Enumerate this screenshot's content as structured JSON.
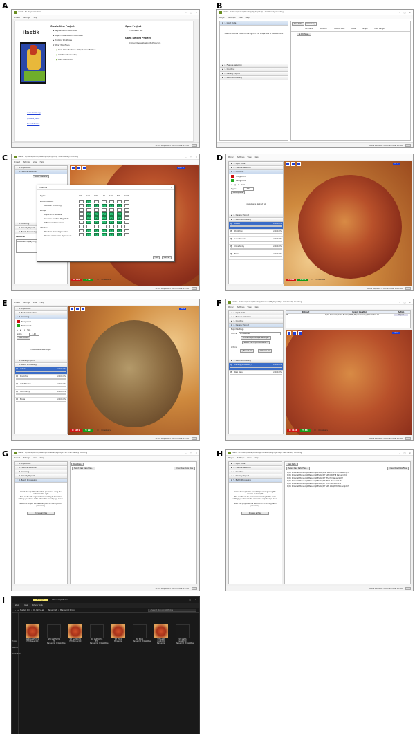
{
  "panels": {
    "A": {
      "letter": "A",
      "title": "ilastik - No Project Loaded",
      "menu": [
        "Project",
        "Settings",
        "Help"
      ],
      "logo_text": "ilastik",
      "create_heading": "Create New Project",
      "workflows": [
        "Segmentation Workflows",
        "Object Classification Workflows",
        "Tracking Workflows",
        "Other Workflows"
      ],
      "other_items": [
        "Pixel Classification + Object Classification",
        "Cell Density Counting",
        "Data Conversion"
      ],
      "open_heading": "Open Project",
      "browse": "Browse Files",
      "recent_heading": "Open Recent Project",
      "recent_item": "C:\\Users\\Owner\\Desktop\\MyProject.ilp",
      "links": [
        "www.ilastik.org",
        "@ilastik_team",
        "Switch Theme"
      ],
      "status": "Active Requests: 0  Cached Data: 0.0 MB"
    },
    "B": {
      "letter": "B",
      "title": "ilastik - C:/Users/Owner/Desktop/MyProject.ilp - Cell Density Counting",
      "menu": [
        "Project",
        "Settings",
        "View",
        "Help"
      ],
      "applets": [
        "1. Input Data",
        "2. Feature Selection",
        "3. Counting",
        "4. Density Export",
        "5. Batch Processing"
      ],
      "hint": "Use the controls shown to the right to add image files to this workflow.",
      "tabs": [
        "Raw Data",
        "Summary"
      ],
      "columns": [
        "Nickname",
        "Location",
        "Internal Path",
        "Axes",
        "Shape",
        "Data Range"
      ],
      "add_button": "Add New...",
      "status": "Active Requests: 0  Cached Data: 0.0 MB"
    },
    "C": {
      "letter": "C",
      "title": "ilastik - C:/Users/Owner/Desktop/MyProject.ilp - Cell Density Counting",
      "menu": [
        "Project",
        "Settings",
        "View",
        "Help"
      ],
      "applets": [
        "1. Input Data",
        "2. Feature Selection"
      ],
      "select_btn": "Select Features",
      "dialog_title": "Features",
      "sigma_label": "Sigma",
      "sigmas": [
        "0.30",
        "0.70",
        "1.00",
        "1.60",
        "3.50",
        "5.00",
        "10.00"
      ],
      "feature_rows": [
        "Color/Intensity",
        "Gaussian Smoothing",
        "Edge",
        "Laplacian of Gaussian",
        "Gaussian Gradient Magnitude",
        "Difference of Gaussians",
        "Texture",
        "Structure Tensor Eigenvalues",
        "Hessian of Gaussian Eigenvalues"
      ],
      "ok": "OK",
      "cancel": "Cancel",
      "below_applets": [
        "3. Counting",
        "4. Density Export",
        "5. Batch Processing"
      ],
      "features_label": "Features",
      "features_item": "Raw Data (display only)",
      "x_val": "X: 665",
      "y_val": "Y: 397",
      "crosshair": "Crosshairs",
      "zoom": "100 %",
      "status": "Active Requests: 0  Cached Data: 0.0 MB"
    },
    "D": {
      "letter": "D",
      "menu": [
        "Project",
        "Settings",
        "View",
        "Help"
      ],
      "applets": [
        "1. Input Data",
        "2. Feature Selection",
        "3. Counting"
      ],
      "labels": [
        "Foreground",
        "Background"
      ],
      "size_label": "Size",
      "sigma_label": "Sigma",
      "sigma_value": "3.43",
      "live_update": "Live Update",
      "no_boxes": "no elements defined yet",
      "below_applets": [
        "4. Density Export",
        "5. Batch Processing"
      ],
      "layers": [
        "Labels",
        "Prediction",
        "LabelPreview",
        "Uncertainty",
        "Boxes"
      ],
      "x_val": "X: 812",
      "y_val": "Y: 215",
      "crosshair": "Crosshairs",
      "zoom": "51 %",
      "status": "Active Requests: 0  Cached Data: 135.0 MB"
    },
    "E": {
      "letter": "E",
      "menu": [
        "Project",
        "Settings",
        "View",
        "Help"
      ],
      "applets": [
        "1. Input Data",
        "2. Feature Selection",
        "3. Counting"
      ],
      "labels": [
        "Foreground",
        "Background"
      ],
      "size_label": "Size",
      "sigma_label": "Sigma",
      "sigma_value": "3.43",
      "live_update": "Live Update",
      "no_boxes": "no elements defined yet",
      "below_applets": [
        "4. Density Export",
        "5. Batch Processing"
      ],
      "layers": [
        "Labels",
        "Prediction",
        "LabelPreview",
        "Uncertainty",
        "Boxes"
      ],
      "x_val": "X: 1071",
      "y_val": "Y: 222",
      "crosshair": "Crosshairs",
      "zoom": "54 %",
      "status": "Active Requests: 0  Cached Data: 0.0 MB"
    },
    "F": {
      "letter": "F",
      "title": "ilastik - C:/Users/Owner/Desktop/Processed/MyProject.ilp - Cell Density Counting",
      "menu": [
        "Project",
        "Settings",
        "View",
        "Help"
      ],
      "applets": [
        "1. Input Data",
        "2. Feature Selection",
        "3. Counting",
        "4. Density Export"
      ],
      "export_settings": "Export Settings",
      "source_label": "Source:",
      "source_value": "Probabilities",
      "choose_btn": "Choose Export Image Settings...",
      "select_btn": "Select CSV Export Location...",
      "actions_label": "Actions",
      "export_all": "Export All",
      "delete_all": "Delete All",
      "below_applets": [
        "5. Batch Processing"
      ],
      "layers": [
        "Density (Probability)",
        "Raw Data"
      ],
      "table_headers": [
        "Dataset",
        "Export Location",
        "Action"
      ],
      "table_row": [
        "Pf1",
        "D:/Dr. Kim's Lab/Poster Photos/WT Pf1/Pf1/{nickname}_Probabilities.h5",
        "Export"
      ],
      "x_val": "X: 1138",
      "y_val": "Y: 832",
      "crosshair": "Crosshairs",
      "zoom": "100 %",
      "status": "Active Requests: 0  Cached Data: 8.0 MB"
    },
    "G": {
      "letter": "G",
      "title": "ilastik - C:/Users/Owner/Desktop/Processed/MyProject.ilp - Cell Density Counting",
      "menu": [
        "Project",
        "Settings",
        "View",
        "Help"
      ],
      "applets": [
        "1. Input Data",
        "2. Feature Selection",
        "3. Counting",
        "4. Density Export",
        "5. Batch Processing"
      ],
      "tab": "Raw Data",
      "select_btn": "Select Raw Data Files...",
      "clear_btn": "Clear Raw Data Files",
      "instructions": "Select the input files for batch processing using the controls on the right.",
      "instructions2": "The results will be generated according to the same settings you chose in the interactive export page above.",
      "note": "Note: this project will be saved prior to running batch processing.",
      "process_btn": "Process all files",
      "status": "Active Requests: 0  Cached Data: 0.0 MB"
    },
    "H": {
      "letter": "H",
      "title": "ilastik - C:/Users/Owner/Desktop/Processed/MyProject.ilp - Cell Density Counting",
      "menu": [
        "Project",
        "Settings",
        "View",
        "Help"
      ],
      "applets": [
        "1. Input Data",
        "2. Feature Selection",
        "3. Counting",
        "4. Density Export",
        "5. Batch Processing"
      ],
      "tab": "Raw Data",
      "select_btn": "Select Raw Data Files...",
      "clear_btn": "Clear Raw Data Files",
      "files": [
        "D:/Dr. Kim's Lab Manuscript/Manuscript Photos/GMR GaloSCYC1 ET8 Manuscript.tif",
        "D:/Dr. Kim's Lab Manuscript/Manuscript Photos/WT GMR/CYO ET8 Manuscript.tif",
        "D:/Dr. Kim's Lab Manuscript/Manuscript Photos/WT Pf1/CYO Manuscript.tif",
        "D:/Dr. Kim's Lab Manuscript/Manuscript Photos/WT Pf1C1 Manuscript.tif",
        "D:/Dr. Kim's Lab Manuscript/Manuscript Photos/WT Pf1C3 Manuscript.tif",
        "D:/Dr. Kim's Lab Manuscript/Manuscript Photos/WT GMR GAL4/CYO Manuscript.tif"
      ],
      "instructions": "Select the input files for batch processing using the controls on the right.",
      "instructions2": "The results will be generated according to the same settings you chose in the interactive export page above.",
      "note": "Note: this project will be saved prior to running batch processing.",
      "process_btn": "Process all files",
      "status": "Active Requests: 0  Cached Data: 0.0 MB"
    },
    "I": {
      "letter": "I",
      "tab_manage": "Manage",
      "tab_name": "Manuscript Photos",
      "ribbon": [
        "Share",
        "View",
        "Picture Tools"
      ],
      "path": [
        "System (D:)",
        "Dr. Kim's Lab",
        "Manuscript",
        "Manuscript Photos"
      ],
      "search_placeholder": "Search Manuscript Photos",
      "side": [
        "Photos",
        "Desktop",
        "Documents"
      ],
      "files": [
        "GMR GalM5CYC1 ET8 Manuscript",
        "GMR GalM5CYC1 ET8 Manuscript_Probabilities",
        "WT GalM6CYC1 ET8 Manuscript",
        "WT GalM6CYC1 ET8 Manuscript_Probabilities",
        "WT Pf1C1 Manuscript",
        "WT Pf1C1 Manuscript_Probabilities",
        "WT GalM6 GAL4/CYO Manuscript",
        "WT GalM6 GAL4/CYO Manuscript_Probabilities"
      ]
    }
  },
  "colors": {
    "accent_blue": "#1f3fd6",
    "x_red": "#d21414",
    "y_green": "#169b18",
    "foreground_label": "#cc1111",
    "background_label": "#22aa22",
    "check_green": "#2ec77a"
  }
}
